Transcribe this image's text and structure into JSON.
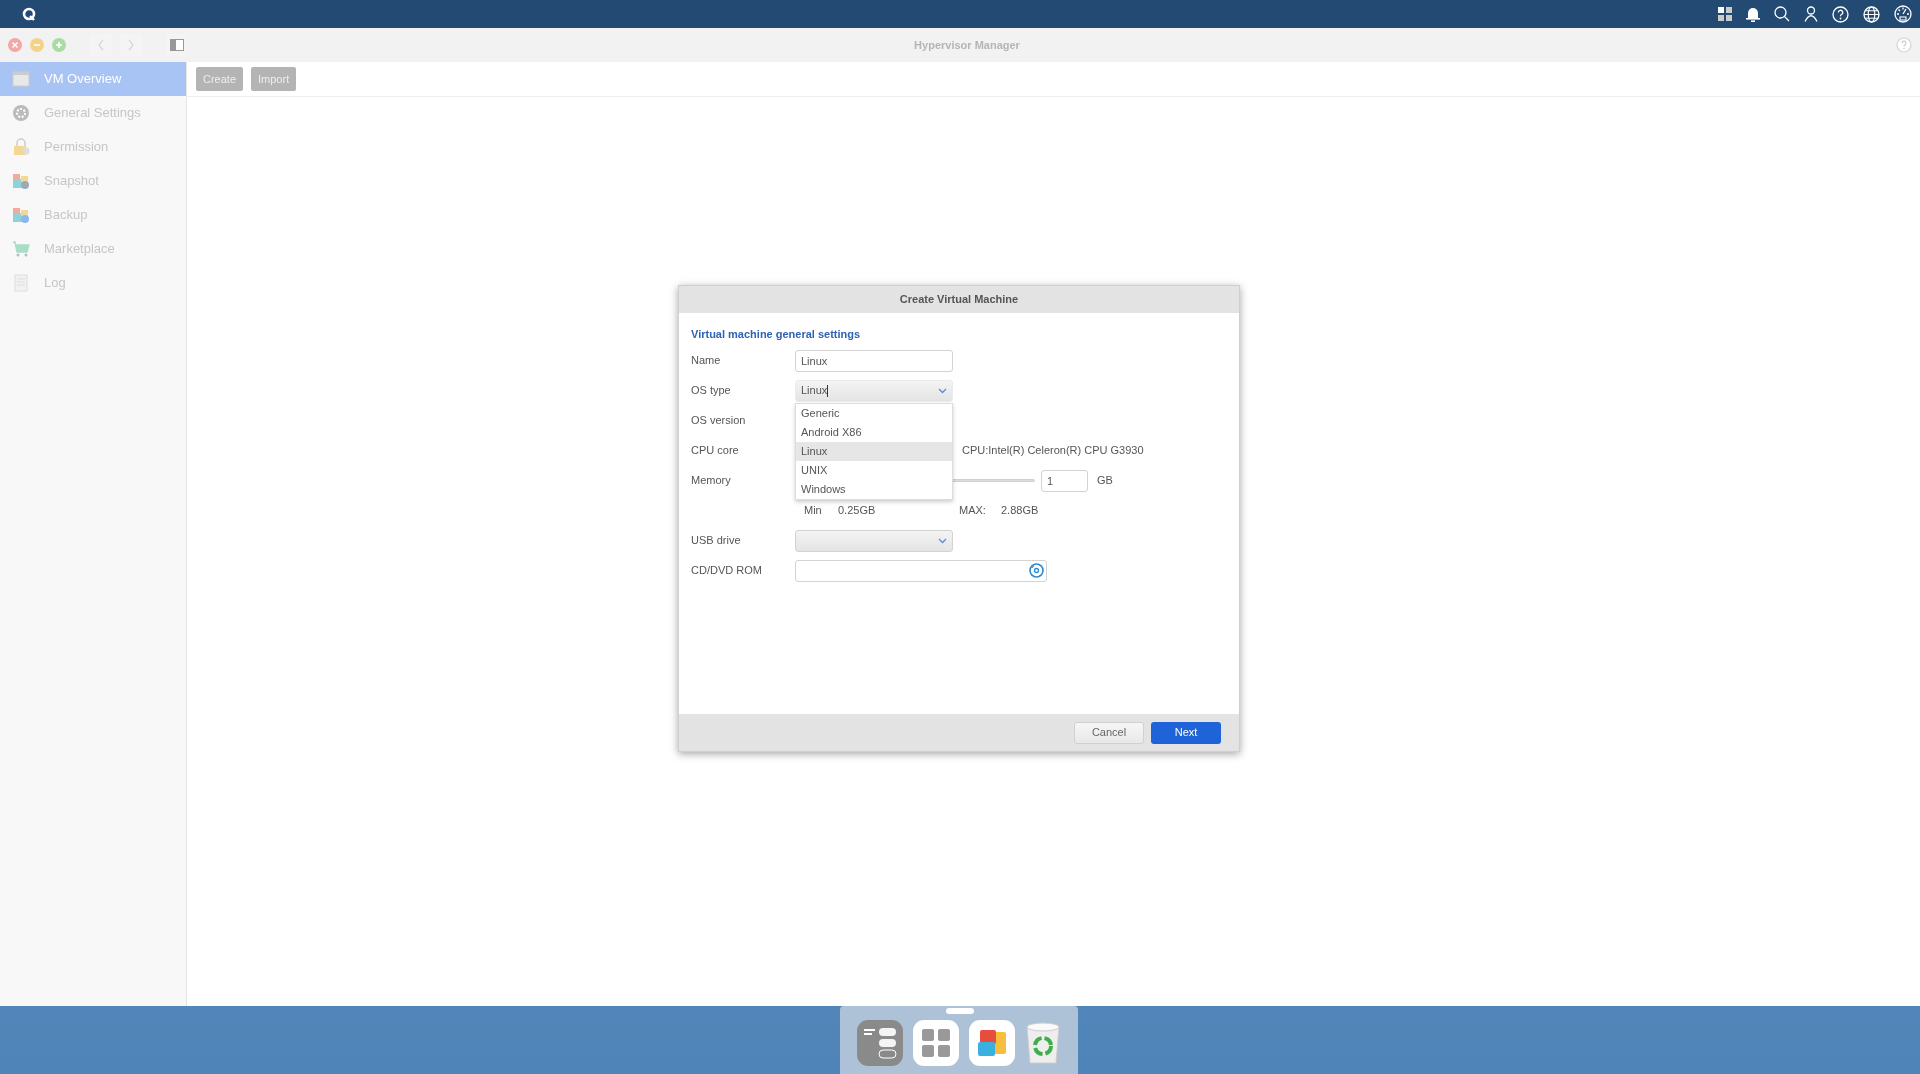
{
  "window": {
    "title": "Hypervisor Manager"
  },
  "sidebar": {
    "items": [
      {
        "label": "VM Overview",
        "kind": "overview",
        "selected": true
      },
      {
        "label": "General Settings",
        "kind": "settings",
        "selected": false
      },
      {
        "label": "Permission",
        "kind": "lock",
        "selected": false
      },
      {
        "label": "Snapshot",
        "kind": "snapshot",
        "selected": false
      },
      {
        "label": "Backup",
        "kind": "backup",
        "selected": false
      },
      {
        "label": "Marketplace",
        "kind": "cart",
        "selected": false
      },
      {
        "label": "Log",
        "kind": "log",
        "selected": false
      }
    ]
  },
  "toolbar": {
    "buttons": [
      "Create",
      "Import"
    ]
  },
  "dialog": {
    "title": "Create Virtual Machine",
    "section": "Virtual machine general settings",
    "fields": [
      {
        "label": "Name",
        "kind": "text",
        "value": "Linux"
      },
      {
        "label": "OS type",
        "kind": "select",
        "value": "Linux",
        "open": true
      },
      {
        "label": "OS version",
        "kind": "hidden"
      },
      {
        "label": "CPU core",
        "kind": "cpu",
        "info": "CPU:Intel(R) Celeron(R) CPU G3930"
      },
      {
        "label": "Memory",
        "kind": "memory",
        "value": "1",
        "unit": "GB",
        "min_label": "Min",
        "min": "0.25GB",
        "max_label": "MAX:",
        "max": "2.88GB"
      },
      {
        "label": "USB drive",
        "kind": "select",
        "open": false
      },
      {
        "label": "CD/DVD ROM",
        "kind": "file"
      }
    ],
    "dropdown": {
      "options": [
        {
          "label": "Generic",
          "selected": false
        },
        {
          "label": "Android X86",
          "selected": false
        },
        {
          "label": "Linux",
          "selected": true
        },
        {
          "label": "UNIX",
          "selected": false
        },
        {
          "label": "Windows",
          "selected": false
        }
      ]
    },
    "buttons": [
      {
        "label": "Cancel",
        "kind": "secondary"
      },
      {
        "label": "Next",
        "kind": "primary"
      }
    ]
  }
}
